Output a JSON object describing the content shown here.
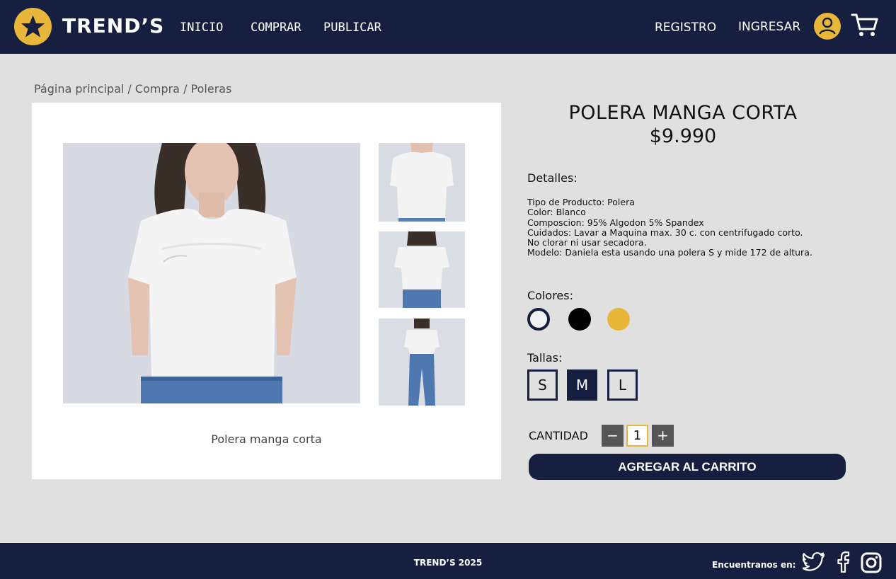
{
  "header": {
    "brand": "TREND’S",
    "nav": [
      "INICIO",
      "COMPRAR",
      "PUBLICAR"
    ],
    "register": "REGISTRO",
    "login": "INGRESAR"
  },
  "breadcrumb": "Página principal / Compra / Poleras",
  "gallery": {
    "caption": "Polera manga corta"
  },
  "product": {
    "title": "POLERA MANGA CORTA",
    "price": "$9.990",
    "details_label": "Detalles:",
    "details": [
      "Tipo de Producto: Polera",
      "Color: Blanco",
      "Composcion: 95% Algodon 5% Spandex",
      "Cuidados: Lavar a Maquina max. 30 c. con centrifugado corto.",
      "No clorar ni usar secadora.",
      "Modelo: Daniela esta usando una polera S y mide 172 de altura."
    ],
    "colors_label": "Colores:",
    "colors": [
      "#f1f1f1",
      "#000000",
      "#e8b73a"
    ],
    "sizes_label": "Tallas:",
    "sizes": [
      "S",
      "M",
      "L"
    ],
    "selected_size": "M",
    "quantity_label": "CANTIDAD",
    "quantity": "1",
    "minus": "−",
    "plus": "+",
    "add_to_cart": "AGREGAR AL CARRITO"
  },
  "footer": {
    "copyright": "TREND’S 2025",
    "find_us": "Encuentranos en:"
  },
  "theme": {
    "navy": "#161f3f",
    "gold": "#e8b73a",
    "background": "#e0e0e0"
  }
}
